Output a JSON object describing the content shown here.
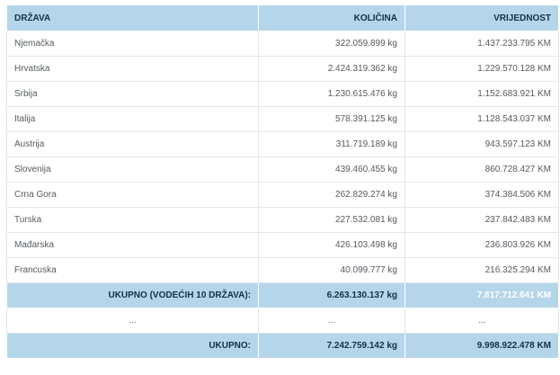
{
  "header": {
    "col_country": "DRŽAVA",
    "col_quantity": "KOLIČINA",
    "col_value": "VRIJEDNOST"
  },
  "rows": [
    {
      "country": "Njemačka",
      "quantity": "322.059.899 kg",
      "value": "1.437.233.795 KM"
    },
    {
      "country": "Hrvatska",
      "quantity": "2.424.319.362 kg",
      "value": "1.229.570.128 KM"
    },
    {
      "country": "Srbija",
      "quantity": "1.230.615.476 kg",
      "value": "1.152.683.921 KM"
    },
    {
      "country": "Italija",
      "quantity": "578.391.125 kg",
      "value": "1.128.543.037 KM"
    },
    {
      "country": "Austrija",
      "quantity": "311.719.189 kg",
      "value": "943.597.123 KM"
    },
    {
      "country": "Slovenija",
      "quantity": "439.460.455 kg",
      "value": "860.728.427 KM"
    },
    {
      "country": "Crna Gora",
      "quantity": "262.829.274 kg",
      "value": "374.384.506 KM"
    },
    {
      "country": "Turska",
      "quantity": "227.532.081 kg",
      "value": "237.842.483 KM"
    },
    {
      "country": "Mađarska",
      "quantity": "426.103.498 kg",
      "value": "236.803.926 KM"
    },
    {
      "country": "Francuska",
      "quantity": "40.099.777 kg",
      "value": "216.325.294 KM"
    }
  ],
  "subtotal": {
    "label": "UKUPNO (VODEĆIH 10 DRŽAVA):",
    "quantity": "6.263.130.137 kg",
    "value": "7.817.712.641 KM"
  },
  "ellipsis": {
    "c1": "...",
    "c2": "...",
    "c3": "..."
  },
  "total": {
    "label": "UKUPNO:",
    "quantity": "7.242.759.142 kg",
    "value": "9.998.922.478 KM"
  },
  "colors": {
    "header_bg": "#b5d6ea",
    "header_text": "#123247",
    "body_text": "#555b60"
  }
}
